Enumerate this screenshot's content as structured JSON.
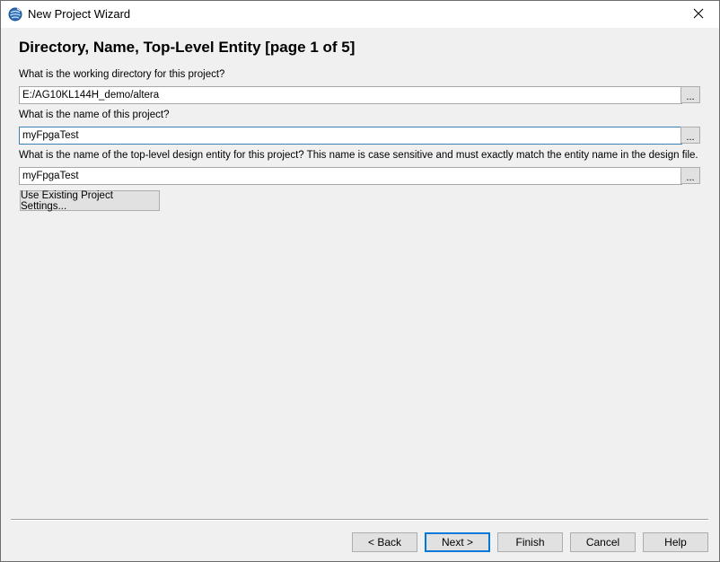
{
  "window": {
    "title": "New Project Wizard",
    "icon": "quartus-globe-icon",
    "close_glyph": "✕"
  },
  "page": {
    "title": "Directory, Name, Top-Level Entity [page 1 of 5]"
  },
  "fields": {
    "working_directory": {
      "label": "What is the working directory for this project?",
      "value": "E:/AG10KL144H_demo/altera",
      "browse_label": "..."
    },
    "project_name": {
      "label": "What is the name of this project?",
      "value": "myFpgaTest",
      "browse_label": "..."
    },
    "top_level_entity": {
      "label": "What is the name of the top-level design entity for this project? This name is case sensitive and must exactly match the entity name in the design file.",
      "value": "myFpgaTest",
      "browse_label": "..."
    }
  },
  "use_existing_label": "Use Existing Project Settings...",
  "footer": {
    "back_label": "< Back",
    "next_label": "Next >",
    "finish_label": "Finish",
    "cancel_label": "Cancel",
    "help_label": "Help"
  },
  "colors": {
    "focus_border": "#3c7fb1",
    "default_button_border": "#0078d7",
    "dialog_background": "#f0f0f0"
  }
}
